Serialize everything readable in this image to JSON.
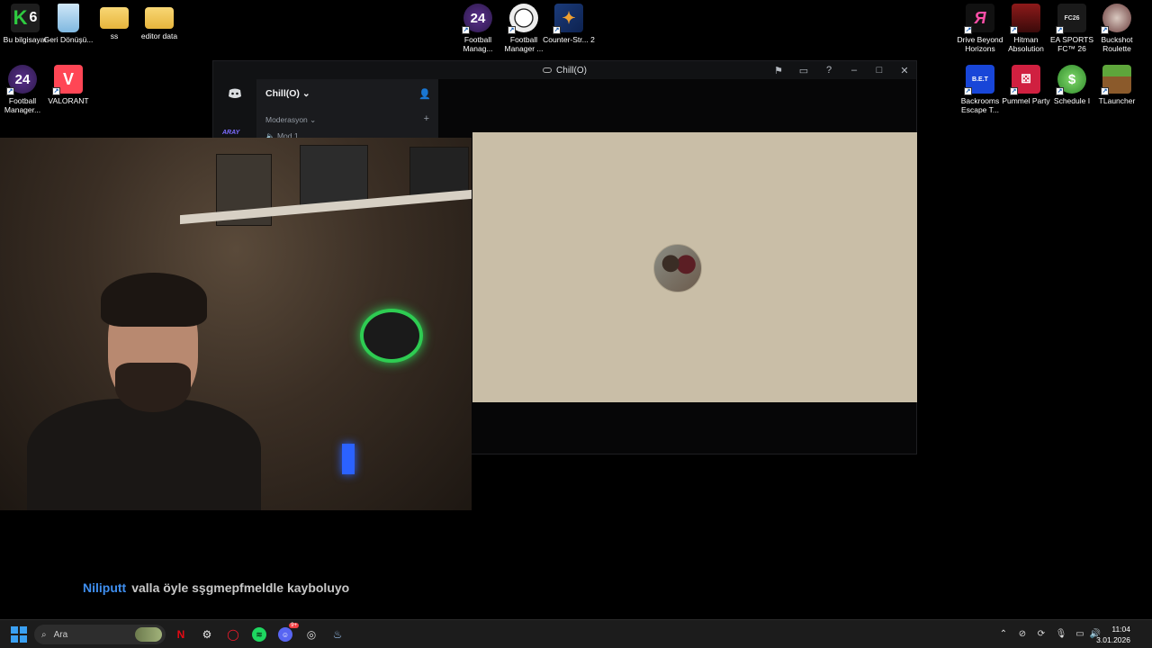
{
  "desktop": {
    "icons_left": [
      {
        "label": "Bu bilgisayar",
        "icon": "k-monitor-icon",
        "badge": "6"
      },
      {
        "label": "Geri Dönüşü...",
        "icon": "recycle-bin-icon"
      },
      {
        "label": "ss",
        "icon": "folder-icon"
      },
      {
        "label": "editor data",
        "icon": "folder-icon"
      },
      {
        "label": "Football Manager...",
        "icon": "fm24-icon",
        "glyph": "24"
      },
      {
        "label": "VALORANT",
        "icon": "valorant-icon"
      }
    ],
    "icons_center": [
      {
        "label": "Football Manag...",
        "icon": "fm24-icon",
        "glyph": "24"
      },
      {
        "label": "Football Manager ...",
        "icon": "football-icon"
      },
      {
        "label": "Counter-Str... 2",
        "icon": "cs2-icon"
      }
    ],
    "icons_right": [
      {
        "label": "Drive Beyond Horizons",
        "icon": "drive-beyond-icon"
      },
      {
        "label": "Hitman Absolution",
        "icon": "hitman-icon"
      },
      {
        "label": "EA SPORTS FC™ 26",
        "icon": "easports-fc-icon",
        "glyph": "FC26"
      },
      {
        "label": "Buckshot Roulette",
        "icon": "buckshot-icon"
      },
      {
        "label": "Backrooms Escape T...",
        "icon": "backrooms-icon",
        "glyph": "B.E.T"
      },
      {
        "label": "Pummel Party",
        "icon": "pummel-party-icon"
      },
      {
        "label": "Schedule I",
        "icon": "schedule-icon"
      },
      {
        "label": "TLauncher",
        "icon": "tlauncher-icon"
      }
    ]
  },
  "discord": {
    "window_title": "Chill(O)",
    "guild_name": "Chill(O)",
    "server_short": "ARAY",
    "category": "Moderasyon",
    "channel": "Mod 1",
    "colors": {
      "stage_bg": "#c9bea7",
      "sidebar_bg": "#1a1b1e"
    }
  },
  "chat": {
    "username": "Niliputt",
    "message": "valla öyle sşgmepfmeldle kayboluyo",
    "username_color": "#3f8ff0"
  },
  "taskbar": {
    "search_placeholder": "Ara",
    "apps": [
      "netflix-icon",
      "settings-icon",
      "opera-icon",
      "spotify-icon",
      "discord-icon",
      "chrome-icon",
      "steam-icon"
    ],
    "discord_badge": "9+",
    "time": "11:04",
    "date": "3.01.2026"
  }
}
